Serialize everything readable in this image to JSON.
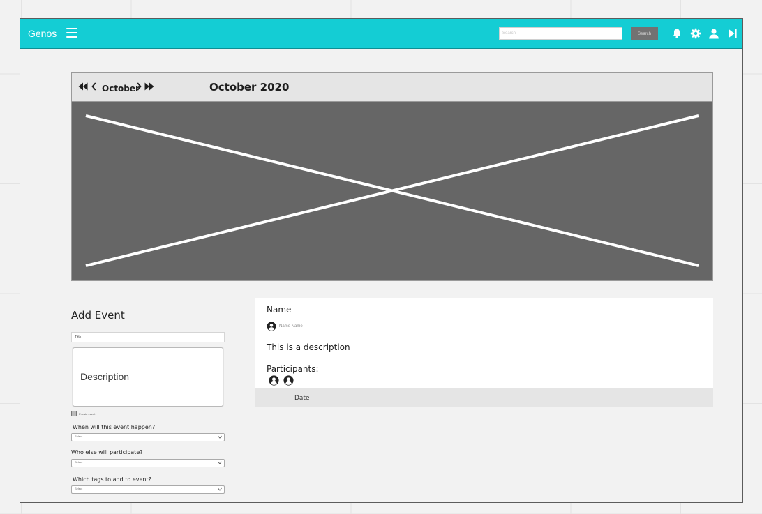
{
  "app": {
    "brand": "Genos",
    "accent_color": "#14cdd4"
  },
  "header": {
    "search_placeholder": "Search",
    "search_button_label": "Search",
    "icons": [
      "menu-icon",
      "bell-icon",
      "gear-icon",
      "user-icon",
      "logout-icon"
    ]
  },
  "calendar": {
    "month_label": "October",
    "title": "October 2020",
    "placeholder_color": "#666666",
    "nav_icons": [
      "double-chevron-left-icon",
      "chevron-left-icon",
      "chevron-right-icon",
      "double-chevron-right-icon"
    ]
  },
  "add_event": {
    "heading": "Add Event",
    "title_placeholder": "Title",
    "description_placeholder": "Description",
    "checkbox_label": "Private event",
    "fields": [
      {
        "label": "When will this event happen?",
        "value": "Select"
      },
      {
        "label": "Who else will participate?",
        "value": "Select"
      },
      {
        "label": "Which tags to add to event?",
        "value": "Select"
      }
    ]
  },
  "event_detail": {
    "name_label": "Name",
    "owner_name": "Name Name",
    "description": "This is a description",
    "participants_label": "Participants:",
    "participant_count": 2,
    "date_label": "Date"
  }
}
